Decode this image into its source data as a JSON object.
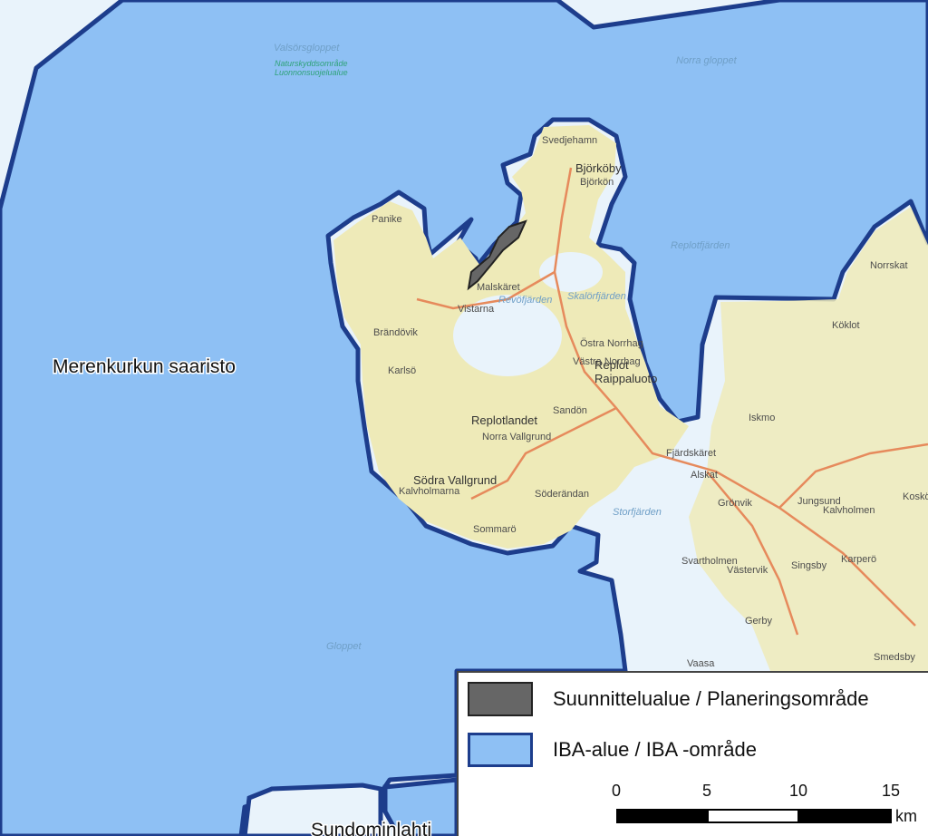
{
  "map": {
    "region_label": "Merenkurkun saaristo",
    "cut_label": "Sundominlahti",
    "places": [
      {
        "name": "Björköby",
        "cls": "big"
      },
      {
        "name": "Svedjehamn",
        "cls": ""
      },
      {
        "name": "Björkön",
        "cls": ""
      },
      {
        "name": "Replot",
        "cls": "big"
      },
      {
        "name": "Raippaluoto",
        "cls": "big"
      },
      {
        "name": "Replotlandet",
        "cls": "big"
      },
      {
        "name": "Norra Vallgrund",
        "cls": ""
      },
      {
        "name": "Södra Vallgrund",
        "cls": "big"
      },
      {
        "name": "Vistarna",
        "cls": ""
      },
      {
        "name": "Malskäret",
        "cls": ""
      },
      {
        "name": "Sandön",
        "cls": ""
      },
      {
        "name": "Söderändan",
        "cls": ""
      },
      {
        "name": "Kalvholmarna",
        "cls": ""
      },
      {
        "name": "Sommarö",
        "cls": ""
      },
      {
        "name": "Iskmo",
        "cls": ""
      },
      {
        "name": "Köklot",
        "cls": ""
      },
      {
        "name": "Norrskat",
        "cls": ""
      },
      {
        "name": "Jungsund",
        "cls": ""
      },
      {
        "name": "Kalvholmen",
        "cls": ""
      },
      {
        "name": "Singsby",
        "cls": ""
      },
      {
        "name": "Karperö",
        "cls": ""
      },
      {
        "name": "Västervik",
        "cls": ""
      },
      {
        "name": "Gerby",
        "cls": ""
      },
      {
        "name": "Vaasa",
        "cls": ""
      },
      {
        "name": "Smedsby",
        "cls": ""
      },
      {
        "name": "Koskö",
        "cls": ""
      },
      {
        "name": "Östra Norrhag",
        "cls": ""
      },
      {
        "name": "Västra Norrhag",
        "cls": ""
      },
      {
        "name": "Panike",
        "cls": ""
      },
      {
        "name": "Karlsö",
        "cls": ""
      },
      {
        "name": "Brändövik",
        "cls": ""
      },
      {
        "name": "Fjärdskäret",
        "cls": ""
      },
      {
        "name": "Alskat",
        "cls": ""
      },
      {
        "name": "Grönvik",
        "cls": ""
      },
      {
        "name": "Svartholmen",
        "cls": ""
      }
    ],
    "water_names": [
      {
        "name": "Norra gloppet",
        "cls": "water"
      },
      {
        "name": "Valsörsgloppet",
        "cls": "water"
      },
      {
        "name": "Gloppet",
        "cls": "water"
      },
      {
        "name": "Replotfjärden",
        "cls": "water"
      },
      {
        "name": "Storfjärden",
        "cls": "water"
      },
      {
        "name": "Revöfjärden",
        "cls": "water"
      },
      {
        "name": "Skalörfjärden",
        "cls": "water"
      },
      {
        "name": "Naturskyddsområde",
        "cls": "green"
      },
      {
        "name": "Luonnonsuojelualue",
        "cls": "green"
      }
    ],
    "colors": {
      "iba_fill": "#8ec0f4",
      "iba_border": "#1d3d8c",
      "land": "#eeeab8",
      "water_open": "#e9f3fb",
      "plan_area": "#666666"
    }
  },
  "legend": {
    "items": [
      {
        "label": "Suunnittelualue / Planeringsområde"
      },
      {
        "label": "IBA-alue / IBA -område"
      }
    ],
    "scale": {
      "ticks": [
        "0",
        "5",
        "10",
        "15"
      ],
      "unit": "km"
    }
  }
}
